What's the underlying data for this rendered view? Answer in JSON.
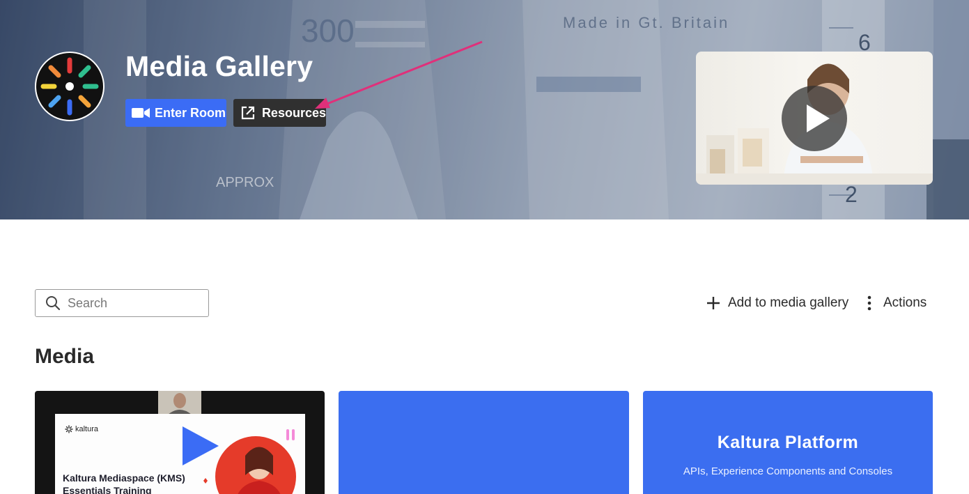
{
  "hero": {
    "title": "Media Gallery",
    "enter_room_label": "Enter Room",
    "resources_label": "Resources",
    "background_text": {
      "volume_mark": "300",
      "made_in_label": "Made in Gt. Britain",
      "approx_label": "APPROX",
      "scale_6": "6",
      "scale_2": "2"
    }
  },
  "toolbar": {
    "search_placeholder": "Search",
    "add_label": "Add to media gallery",
    "actions_label": "Actions"
  },
  "section": {
    "media_title": "Media"
  },
  "cards": [
    {
      "brand": "kaltura",
      "title": "Kaltura Mediaspace (KMS) Essentials Training"
    },
    {},
    {
      "title": "Kaltura Platform",
      "subtitle": "APIs, Experience Components and Consoles"
    }
  ],
  "colors": {
    "primary_button": "#3b6cf5",
    "dark_button": "#303030",
    "card_blue": "#3b6ef0",
    "annotation_arrow": "#e0307a"
  },
  "icons": {
    "enter_room": "video-camera-icon",
    "resources": "external-link-icon",
    "search": "magnifier-icon",
    "add": "plus-icon",
    "actions": "vertical-dots-icon",
    "play": "play-icon"
  }
}
